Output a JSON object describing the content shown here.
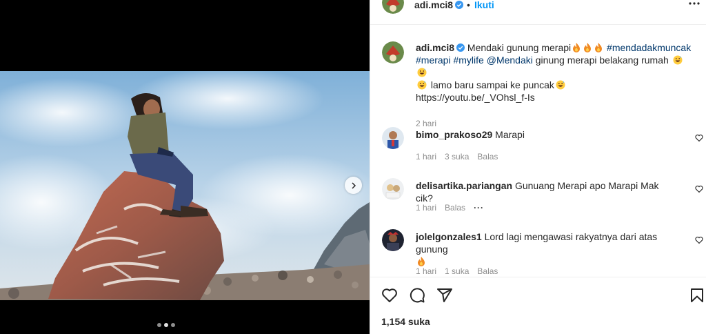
{
  "post": {
    "username": "adi.mci8",
    "follow_label": "Ikuti",
    "separator": "•",
    "caption": {
      "username": "adi.mci8",
      "text_1": "Mendaki gunung merapi",
      "hashtag_1": "#mendadakmuncak",
      "hashtag_2": "#merapi",
      "hashtag_3": "#mylife",
      "mention": "@Mendaki",
      "text_2": "ginung merapi belakang rumah",
      "text_3": "lamo baru sampai ke puncak",
      "url": "https://youtu.be/_VOhsl_f-Is",
      "time": "2 hari"
    },
    "likes": "1,154 suka"
  },
  "comments": [
    {
      "username": "bimo_prakoso29",
      "text": "Marapi",
      "time": "1 hari",
      "likes": "3 suka",
      "reply": "Balas"
    },
    {
      "username": "delisartika.pariangan",
      "text": "Gunuang Merapi apo Marapi Mak cik?",
      "time": "1 hari",
      "reply": "Balas",
      "more": "···"
    },
    {
      "username": "jolelgonzales1",
      "text": "Lord lagi mengawasi rakyatnya dari atas gunung",
      "time": "1 hari",
      "likes": "1 suka",
      "reply": "Balas"
    }
  ],
  "colors": {
    "link": "#00376b",
    "follow": "#0095f6",
    "verified": "#3897f0",
    "muted": "#8e8e8e"
  },
  "icons": [
    "verified-icon",
    "more-icon",
    "fire-emoji",
    "grinning-sweat-emoji",
    "chevron-right-icon",
    "heart-icon",
    "comment-icon",
    "share-icon",
    "bookmark-icon"
  ],
  "carousel": {
    "slides": 3,
    "active": 2
  }
}
